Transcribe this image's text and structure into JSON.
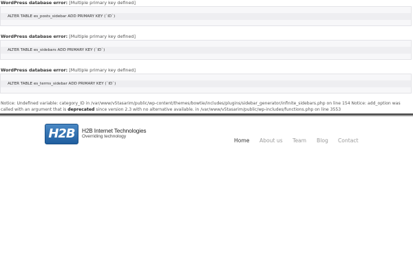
{
  "db_errors": [
    {
      "label": "WordPress database error:",
      "message": "[Multiple primary key defined]",
      "query": "ALTER TABLE es_posts_sidebar ADD PRIMARY KEY (`ID`)"
    },
    {
      "label": "WordPress database error:",
      "message": "[Multiple primary key defined]",
      "query": "ALTER TABLE es_sidebars ADD PRIMARY KEY (`ID`)"
    },
    {
      "label": "WordPress database error:",
      "message": "[Multiple primary key defined]",
      "query": "ALTER TABLE es_terms_sidebar ADD PRIMARY KEY (`ID`)"
    }
  ],
  "notice": {
    "part1": "Notice: Undefined variable: category_ID in /var/www/v5tasarim/public/wp-content/themes/bowtie/includes/plugins/sidebar_generator/infinite_sidebars.php on line 154 Notice: add_option was called with an argument that is ",
    "emphasis": "deprecated",
    "part2": " since version 2.3 with no alternative available. in /var/www/v5tasarim/public/wp-includes/functions.php on line 3553"
  },
  "header": {
    "logo_badge_text": "H2B",
    "site_name": "H2B Internet Technologies",
    "tagline": "Overriding technology",
    "brand_color": "#2a6db0"
  },
  "nav": {
    "items": [
      "Home",
      "About us",
      "Team",
      "Blog",
      "Contact"
    ],
    "active_index": 0
  }
}
